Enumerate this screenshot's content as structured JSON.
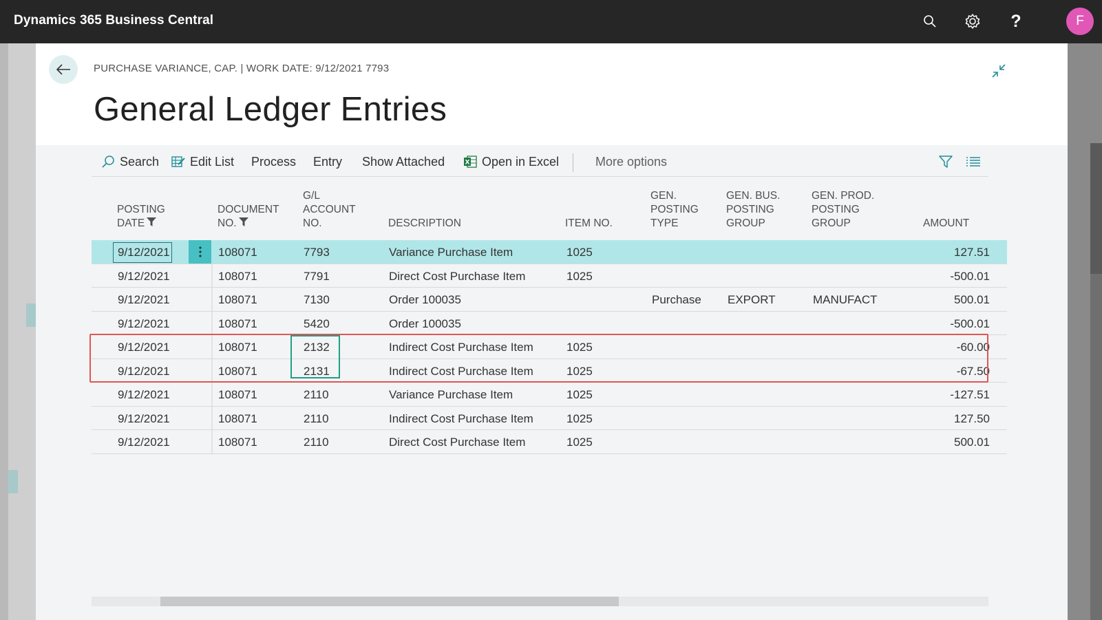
{
  "app": {
    "title": "Dynamics 365 Business Central",
    "avatar_initial": "F"
  },
  "topbar_icons": [
    "search-icon",
    "gear-icon",
    "help-icon"
  ],
  "page": {
    "caption": "PURCHASE VARIANCE, CAP. | WORK DATE: 9/12/2021 7793",
    "title": "General Ledger Entries"
  },
  "actions": {
    "search": "Search",
    "edit_list": "Edit List",
    "process": "Process",
    "entry": "Entry",
    "show_attached": "Show Attached",
    "open_in_excel": "Open in Excel",
    "more_options": "More options"
  },
  "columns": {
    "posting_date": [
      "POSTING",
      "DATE"
    ],
    "document_no": [
      "DOCUMENT",
      "NO."
    ],
    "gl_account_no": [
      "G/L",
      "ACCOUNT",
      "NO."
    ],
    "description": [
      "DESCRIPTION"
    ],
    "item_no": [
      "ITEM NO."
    ],
    "gen_posting_type": [
      "GEN.",
      "POSTING",
      "TYPE"
    ],
    "gen_bus_posting_group": [
      "GEN. BUS.",
      "POSTING",
      "GROUP"
    ],
    "gen_prod_posting_group": [
      "GEN. PROD.",
      "POSTING",
      "GROUP"
    ],
    "amount": [
      "AMOUNT"
    ]
  },
  "rows": [
    {
      "posting_date": "9/12/2021",
      "document_no": "108071",
      "gl_account_no": "7793",
      "description": "Variance Purchase Item",
      "item_no": "1025",
      "gen_posting_type": "",
      "gen_bus_posting_group": "",
      "gen_prod_posting_group": "",
      "amount": "127.51"
    },
    {
      "posting_date": "9/12/2021",
      "document_no": "108071",
      "gl_account_no": "7791",
      "description": "Direct Cost Purchase Item",
      "item_no": "1025",
      "gen_posting_type": "",
      "gen_bus_posting_group": "",
      "gen_prod_posting_group": "",
      "amount": "-500.01"
    },
    {
      "posting_date": "9/12/2021",
      "document_no": "108071",
      "gl_account_no": "7130",
      "description": "Order 100035",
      "item_no": "",
      "gen_posting_type": "Purchase",
      "gen_bus_posting_group": "EXPORT",
      "gen_prod_posting_group": "MANUFACT",
      "amount": "500.01"
    },
    {
      "posting_date": "9/12/2021",
      "document_no": "108071",
      "gl_account_no": "5420",
      "description": "Order 100035",
      "item_no": "",
      "gen_posting_type": "",
      "gen_bus_posting_group": "",
      "gen_prod_posting_group": "",
      "amount": "-500.01"
    },
    {
      "posting_date": "9/12/2021",
      "document_no": "108071",
      "gl_account_no": "2132",
      "description": "Indirect Cost Purchase Item",
      "item_no": "1025",
      "gen_posting_type": "",
      "gen_bus_posting_group": "",
      "gen_prod_posting_group": "",
      "amount": "-60.00"
    },
    {
      "posting_date": "9/12/2021",
      "document_no": "108071",
      "gl_account_no": "2131",
      "description": "Indirect Cost Purchase Item",
      "item_no": "1025",
      "gen_posting_type": "",
      "gen_bus_posting_group": "",
      "gen_prod_posting_group": "",
      "amount": "-67.50"
    },
    {
      "posting_date": "9/12/2021",
      "document_no": "108071",
      "gl_account_no": "2110",
      "description": "Variance Purchase Item",
      "item_no": "1025",
      "gen_posting_type": "",
      "gen_bus_posting_group": "",
      "gen_prod_posting_group": "",
      "amount": "-127.51"
    },
    {
      "posting_date": "9/12/2021",
      "document_no": "108071",
      "gl_account_no": "2110",
      "description": "Indirect Cost Purchase Item",
      "item_no": "1025",
      "gen_posting_type": "",
      "gen_bus_posting_group": "",
      "gen_prod_posting_group": "",
      "amount": "127.50"
    },
    {
      "posting_date": "9/12/2021",
      "document_no": "108071",
      "gl_account_no": "2110",
      "description": "Direct Cost Purchase Item",
      "item_no": "1025",
      "gen_posting_type": "",
      "gen_bus_posting_group": "",
      "gen_prod_posting_group": "",
      "amount": "500.01"
    }
  ],
  "selected_row": 0,
  "colors": {
    "accent": "#47c0c4",
    "selected_row": "#b1e6e8",
    "highlight_red": "#e05555",
    "highlight_green": "#1f9e8c",
    "avatar": "#e157b6"
  }
}
